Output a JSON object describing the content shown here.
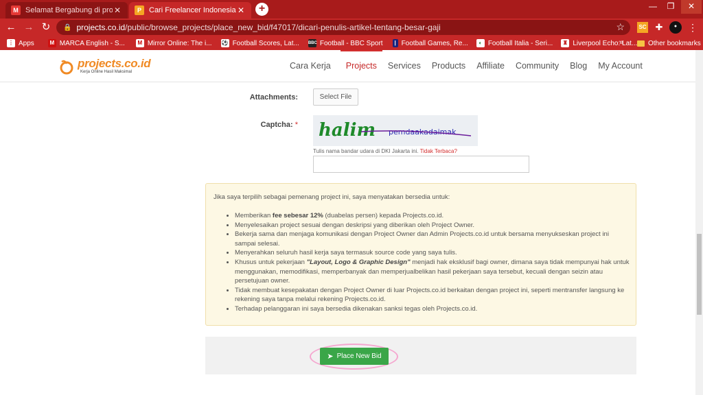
{
  "browser": {
    "tabs": [
      {
        "title": "Selamat Bergabung di projects.co.id",
        "favicon": "gmail-icon"
      },
      {
        "title": "Cari Freelancer Indonesia dan Pekerjaan",
        "favicon": "projects-icon"
      }
    ],
    "new_tab": "+",
    "address": {
      "host": "projects.co.id",
      "path": "/public/browse_projects/place_new_bid/f47017/dicari-penulis-artikel-tentang-besar-gaji"
    },
    "extensions": {
      "sc": "SC"
    },
    "bookmarks": [
      {
        "label": "Apps",
        "icon": "apps-icon"
      },
      {
        "label": "MARCA English - S...",
        "icon": "marca-icon"
      },
      {
        "label": "Mirror Online: The i...",
        "icon": "mirror-icon"
      },
      {
        "label": "Football Scores, Lat...",
        "icon": "football-scores-icon"
      },
      {
        "label": "Football - BBC Sport",
        "icon": "bbc-icon"
      },
      {
        "label": "Football Games, Re...",
        "icon": "football-games-icon"
      },
      {
        "label": "Football Italia - Seri...",
        "icon": "football-italia-icon"
      },
      {
        "label": "Liverpool Echo: Lat...",
        "icon": "liverpool-icon"
      }
    ],
    "more_bookmarks": "»",
    "other_bookmarks": "Other bookmarks"
  },
  "site": {
    "logo_text": "projects.co.id",
    "logo_tagline": "Kerja Online Hasil Maksimal",
    "menu": [
      "Cara Kerja",
      "Projects",
      "Services",
      "Products",
      "Affiliate",
      "Community",
      "Blog",
      "My Account"
    ],
    "active_menu": "Projects"
  },
  "form": {
    "attachments_label": "Attachments:",
    "select_file": "Select File",
    "captcha_label": "Captcha:",
    "required_mark": "*",
    "captcha_image_text": "halim pemdaakadaimak",
    "captcha_hint": "Tulis nama bandar udara di DKI Jakarta ini.",
    "captcha_unreadable": "Tidak Terbaca?",
    "captcha_value": ""
  },
  "notice": {
    "intro": "Jika saya terpilih sebagai pemenang project ini, saya menyatakan bersedia untuk:",
    "items": [
      {
        "pre": "Memberikan ",
        "em": "fee sebesar 12%",
        "post": " (duabelas persen) kepada Projects.co.id."
      },
      {
        "pre": "Menyelesaikan project sesuai dengan deskripsi yang diberikan oleh Project Owner.",
        "em": "",
        "post": ""
      },
      {
        "pre": "Bekerja sama dan menjaga komunikasi dengan Project Owner dan Admin Projects.co.id untuk bersama menyukseskan project ini sampai selesai.",
        "em": "",
        "post": ""
      },
      {
        "pre": "Menyerahkan seluruh hasil kerja saya termasuk source code yang saya tulis.",
        "em": "",
        "post": ""
      },
      {
        "pre": "Khusus untuk pekerjaan ",
        "em": "\"Layout, Logo & Graphic Design\"",
        "post": " menjadi hak eksklusif bagi owner, dimana saya tidak mempunyai hak untuk menggunakan, memodifikasi, memperbanyak dan memperjualbelikan hasil pekerjaan saya tersebut, kecuali dengan seizin atau persetujuan owner."
      },
      {
        "pre": "Tidak membuat kesepakatan dengan Project Owner di luar Projects.co.id berkaitan dengan project ini, seperti mentransfer langsung ke rekening saya tanpa melalui rekening Projects.co.id.",
        "em": "",
        "post": ""
      },
      {
        "pre": "Terhadap pelanggaran ini saya bersedia dikenakan sanksi tegas oleh Projects.co.id.",
        "em": "",
        "post": ""
      }
    ]
  },
  "bid_button": "Place New Bid",
  "colors": {
    "brand_red": "#c62828",
    "logo_orange": "#f08a24",
    "bid_green": "#3aa648",
    "highlight_pink": "#f5a6cf"
  }
}
